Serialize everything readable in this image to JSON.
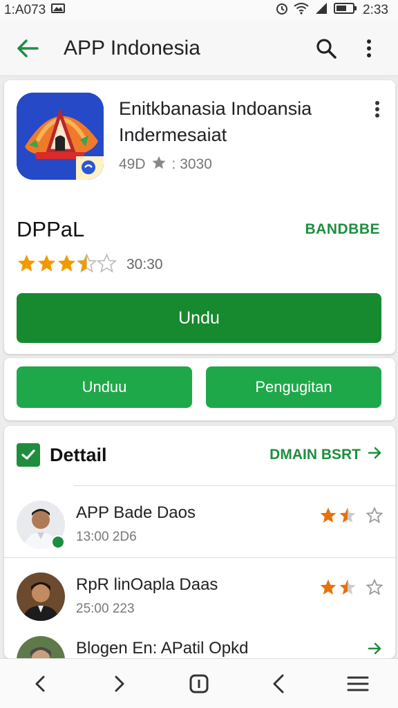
{
  "status_bar": {
    "left_text": "1:A073",
    "time": "2:33",
    "icons": [
      "image-icon",
      "alarm-icon",
      "wifi-icon",
      "signal-icon",
      "battery-icon"
    ]
  },
  "app_bar": {
    "title": "APP Indonesia",
    "back_icon": "arrow-left-icon",
    "actions": [
      "search-icon",
      "more-vert-icon"
    ]
  },
  "app_card": {
    "app_name": "Enitkbanasia Indoansia Indermesaiat",
    "meta_left": "49D",
    "meta_right": ": 3030",
    "developer": "DPPaL",
    "developer_tag": "BANDBBE",
    "rating_stars": 3.5,
    "rating_count": "30:30",
    "primary_button": "Undu",
    "colors": {
      "primary": "#178a2f",
      "accent": "#1e8e3e",
      "star": "#f29900"
    }
  },
  "button_row": {
    "left_button": "Unduu",
    "right_button": "Pengugitan"
  },
  "detail": {
    "title": "Dettail",
    "link": "DMAIN BSRT",
    "items": [
      {
        "title": "APP Bade Daos",
        "subtitle": "13:00  2D6",
        "stars": 1.5
      },
      {
        "title": "RpR linOapla Daas",
        "subtitle": "25:00  223",
        "stars": 1.5
      },
      {
        "title": "Blogen En: APatil Opkd",
        "subtitle": "",
        "stars": 0
      }
    ]
  },
  "nav_bar": {
    "buttons": [
      "chevron-left-icon",
      "chevron-right-icon",
      "tabs-icon",
      "back-icon",
      "menu-icon"
    ]
  }
}
